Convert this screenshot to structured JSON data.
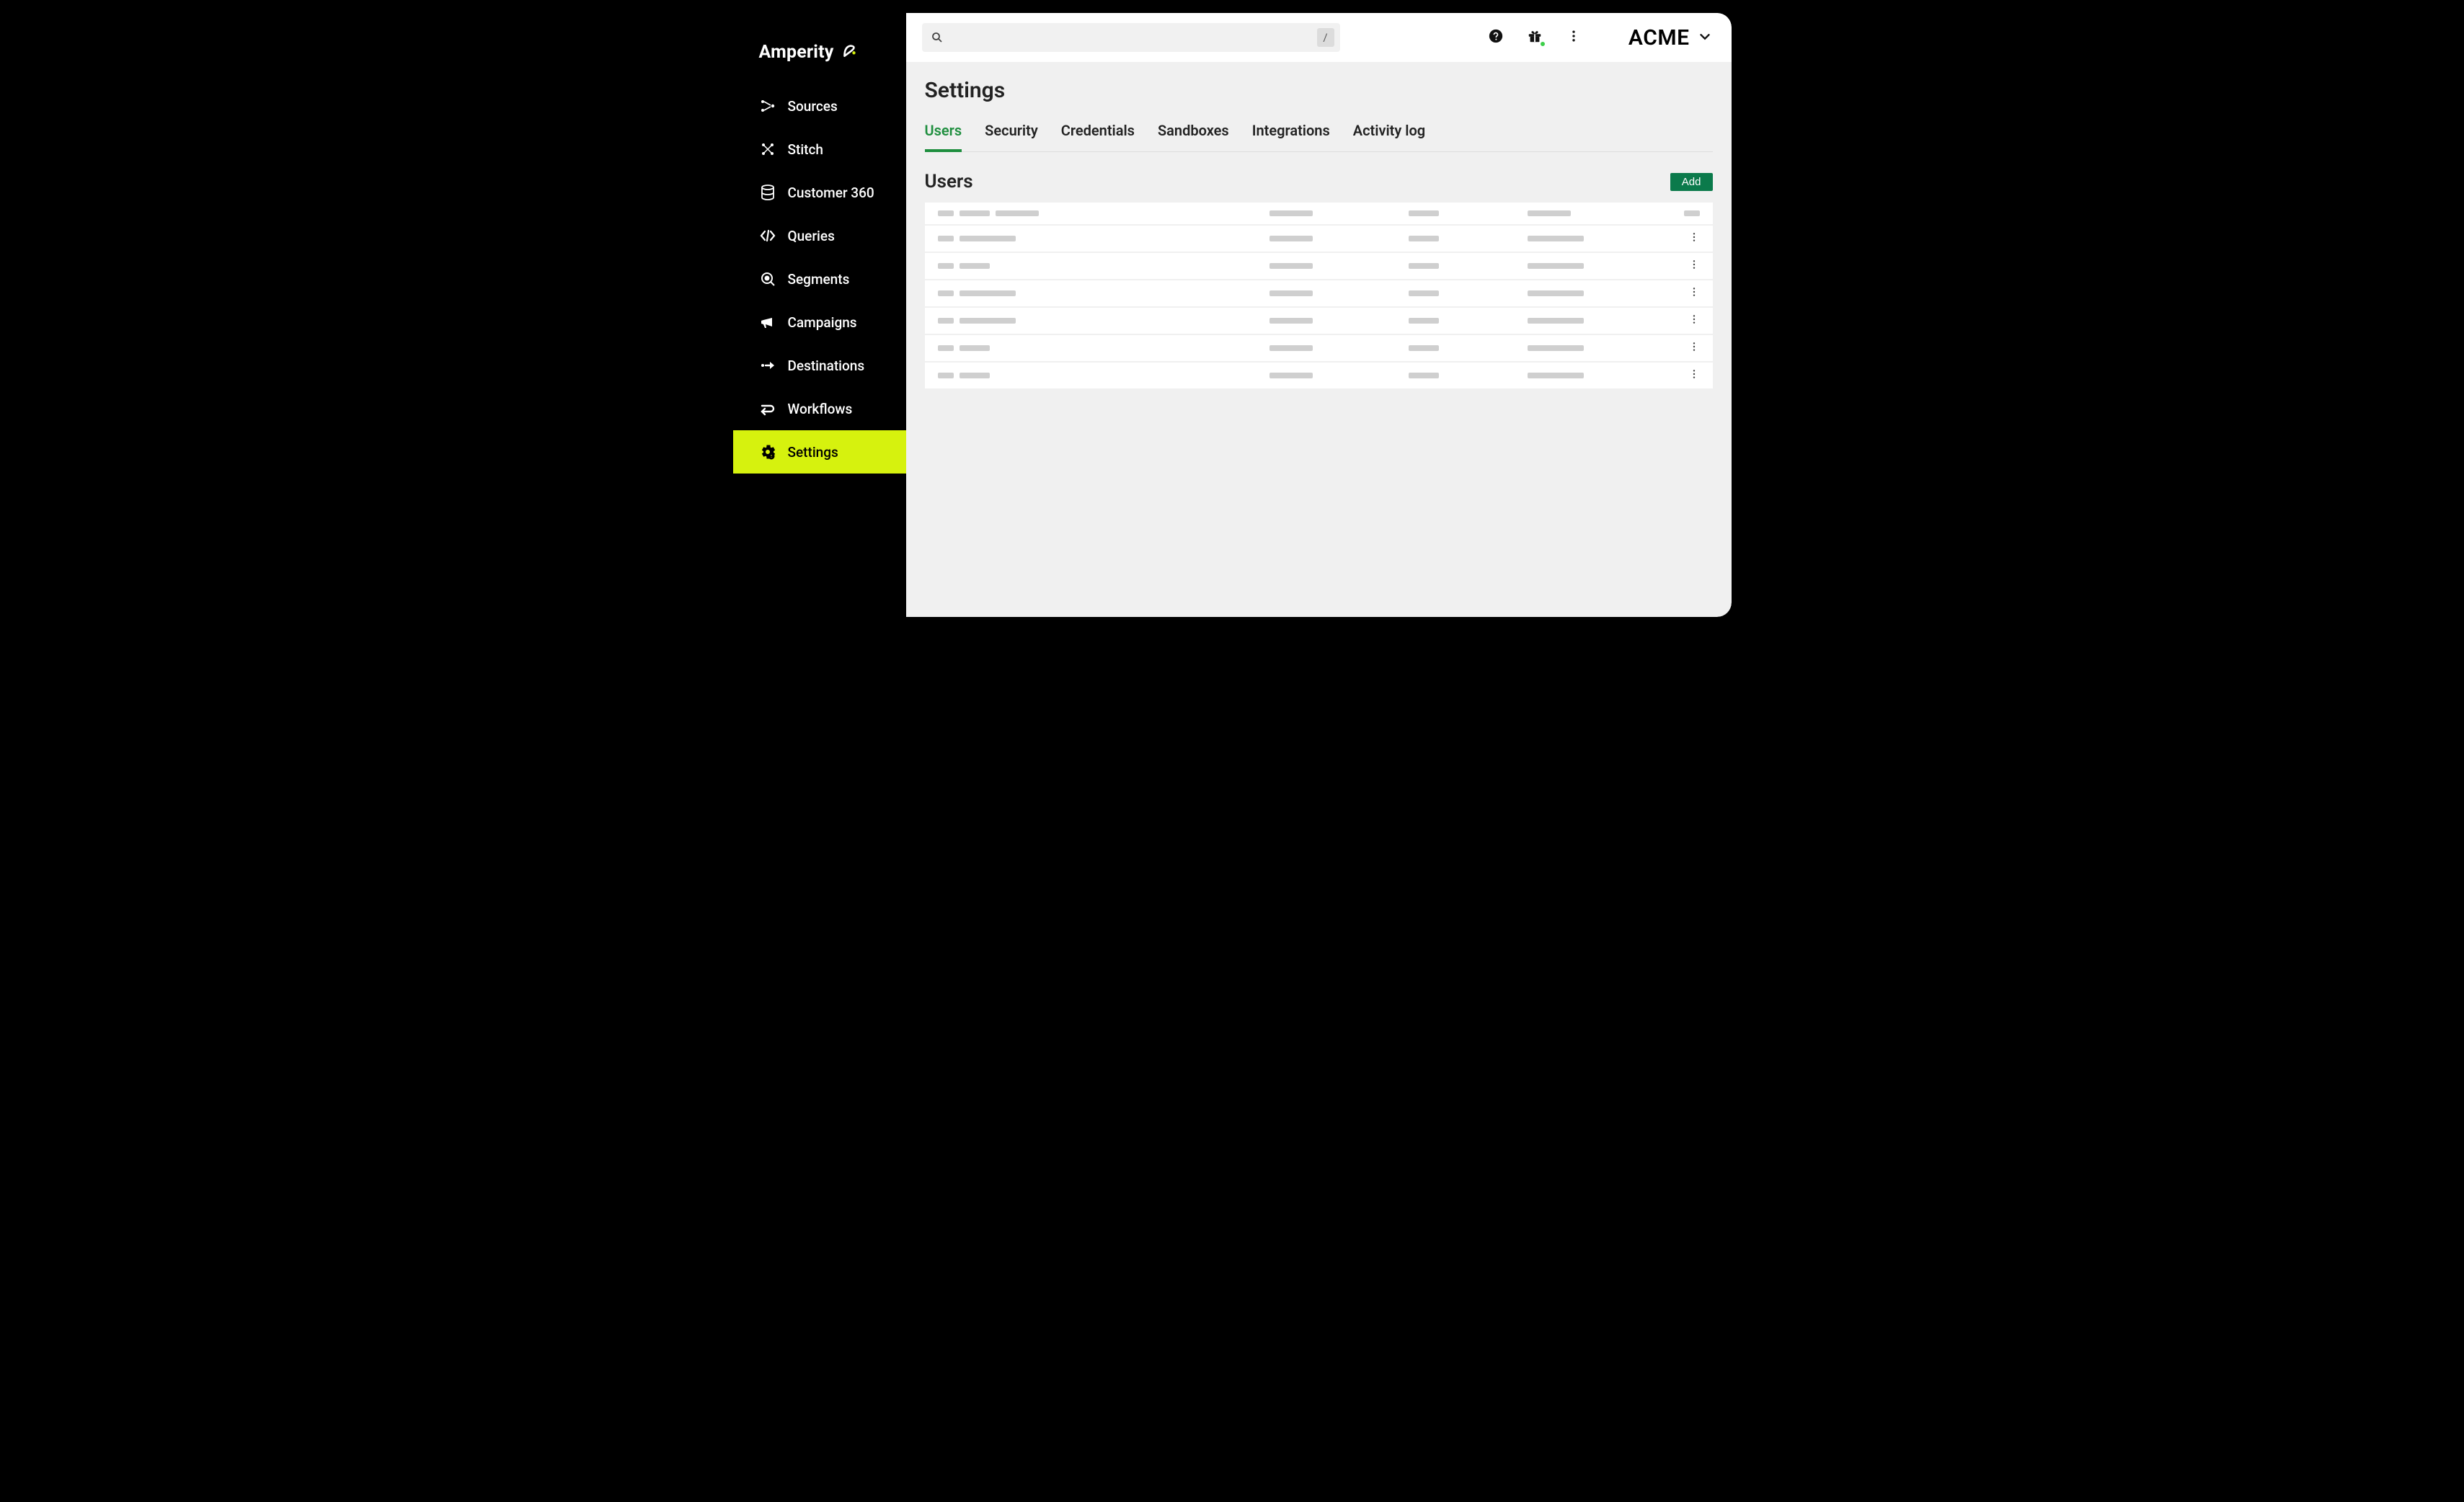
{
  "brand": {
    "name": "Amperity"
  },
  "sidebar": {
    "items": [
      {
        "label": "Sources",
        "icon": "sources-icon"
      },
      {
        "label": "Stitch",
        "icon": "stitch-icon"
      },
      {
        "label": "Customer 360",
        "icon": "database-icon"
      },
      {
        "label": "Queries",
        "icon": "code-icon"
      },
      {
        "label": "Segments",
        "icon": "search-target-icon"
      },
      {
        "label": "Campaigns",
        "icon": "megaphone-icon"
      },
      {
        "label": "Destinations",
        "icon": "arrow-out-icon"
      },
      {
        "label": "Workflows",
        "icon": "workflow-icon"
      },
      {
        "label": "Settings",
        "icon": "gear-icon"
      }
    ],
    "active_index": 8
  },
  "topbar": {
    "search_placeholder": "",
    "search_hotkey": "/",
    "tenant": "ACME"
  },
  "page": {
    "title": "Settings",
    "tabs": [
      {
        "label": "Users"
      },
      {
        "label": "Security"
      },
      {
        "label": "Credentials"
      },
      {
        "label": "Sandboxes"
      },
      {
        "label": "Integrations"
      },
      {
        "label": "Activity log"
      }
    ],
    "active_tab_index": 0,
    "section_title": "Users",
    "add_label": "Add",
    "rows": [
      {
        "is_header": true
      },
      {
        "is_header": false
      },
      {
        "is_header": false
      },
      {
        "is_header": false
      },
      {
        "is_header": false
      },
      {
        "is_header": false
      },
      {
        "is_header": false
      }
    ]
  }
}
